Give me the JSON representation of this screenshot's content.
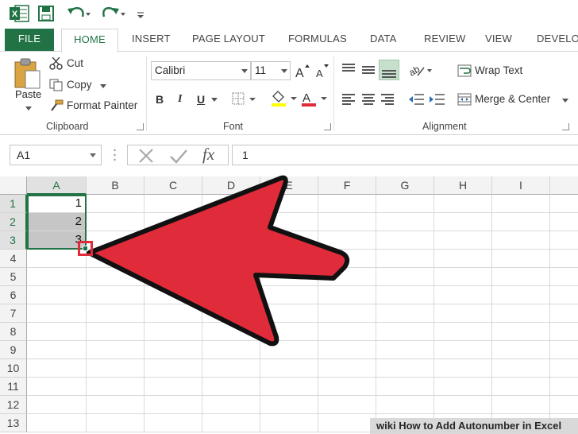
{
  "quick_access": {
    "icons": [
      "excel-logo-icon",
      "save-icon",
      "undo-icon",
      "redo-icon",
      "customize-icon"
    ]
  },
  "tabs": [
    {
      "label": "FILE"
    },
    {
      "label": "HOME"
    },
    {
      "label": "INSERT"
    },
    {
      "label": "PAGE LAYOUT"
    },
    {
      "label": "FORMULAS"
    },
    {
      "label": "DATA"
    },
    {
      "label": "REVIEW"
    },
    {
      "label": "VIEW"
    },
    {
      "label": "DEVELO"
    }
  ],
  "clipboard": {
    "paste": "Paste",
    "cut": "Cut",
    "copy": "Copy",
    "format_painter": "Format Painter",
    "group_label": "Clipboard"
  },
  "font": {
    "name": "Calibri",
    "size": "11",
    "bold": "B",
    "italic": "I",
    "underline": "U",
    "group_label": "Font"
  },
  "alignment": {
    "wrap_text": "Wrap Text",
    "merge_center": "Merge & Center",
    "group_label": "Alignment"
  },
  "formula_bar": {
    "name_box": "A1",
    "fx": "fx",
    "value": "1"
  },
  "sheet": {
    "columns": [
      "A",
      "B",
      "C",
      "D",
      "E",
      "F",
      "G",
      "H",
      "I"
    ],
    "rows": [
      "1",
      "2",
      "3",
      "4",
      "5",
      "6",
      "7",
      "8",
      "9",
      "10",
      "11",
      "12",
      "13"
    ],
    "cells": {
      "A1": "1",
      "A2": "2",
      "A3": "3"
    },
    "selected_range": "A1:A3"
  },
  "colors": {
    "accent": "#217346",
    "arrow": "#e02b3a",
    "selection_shade": "#c6c6c6"
  },
  "watermark": {
    "brand": "wiki",
    "text": "How to Add Autonumber in Excel"
  }
}
